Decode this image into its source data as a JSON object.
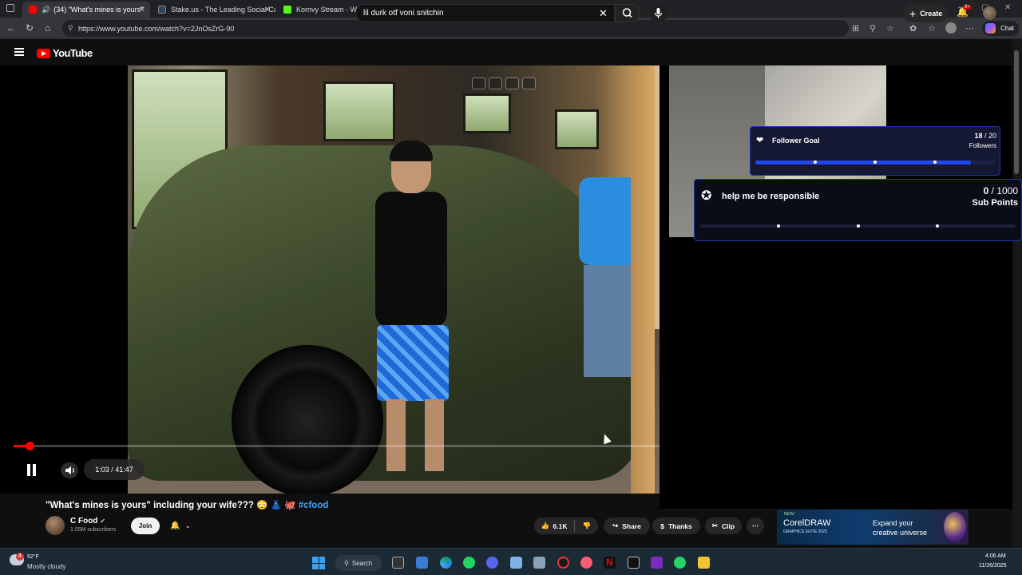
{
  "browser": {
    "tabs": [
      {
        "label": "(34) \"What's mines is yours\"",
        "color": "#ff0000"
      },
      {
        "label": "Stake.us - The Leading Social Ca",
        "color": "#2f4553"
      },
      {
        "label": "Kornvy Stream - Watch Live on Ki",
        "color": "#53fc18"
      }
    ],
    "url": "https://www.youtube.com/watch?v=2JnOsZrG-90",
    "copilot_label": "Chat"
  },
  "youtube": {
    "logo_text": "YouTube",
    "search": {
      "value": "lil durk otf voni snitchin"
    },
    "create_label": "Create",
    "notification_count": "9+"
  },
  "player": {
    "time_display": "1:03 / 41:47",
    "progress_fraction": 0.025
  },
  "overlay": {
    "follower_goal": {
      "title": "Follower Goal",
      "current": "18",
      "separator": " / ",
      "target": "20",
      "label": "Followers",
      "progress_fraction": 0.9
    },
    "sub_goal": {
      "title": "help me be responsible",
      "current": "0",
      "separator": " / ",
      "target": "1000",
      "label": "Sub Points",
      "progress_fraction": 0
    }
  },
  "video": {
    "title": "\"What's mines is yours\" including your wife???",
    "title_emojis": "😳 👗 🐙",
    "hashtag": "#cfood",
    "channel_name": "C Food",
    "subscribers": "1.55M subscribers",
    "join_label": "Join",
    "like_count": "6.1K",
    "share_label": "Share",
    "thanks_label": "Thanks",
    "clip_label": "Clip"
  },
  "ad": {
    "new_label": "NEW!",
    "brand": "CorelDRAW",
    "suite": "GRAPHICS SUITE 2025",
    "tagline": "Expand your creative universe"
  },
  "taskbar": {
    "weather_temp": "52°F",
    "weather_desc": "Mostly cloudy",
    "weather_badge": "4",
    "search_label": "Search",
    "time": "4:06 AM",
    "date": "11/26/2025"
  }
}
